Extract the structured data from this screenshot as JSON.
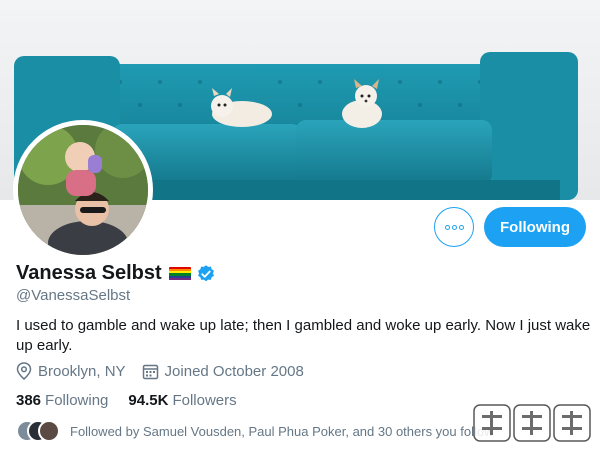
{
  "profile": {
    "display_name": "Vanessa Selbst",
    "handle": "@VanessaSelbst",
    "verified": true,
    "bio": "I used to gamble and wake up late; then I gambled and woke up early. Now I just wake up early.",
    "location": "Brooklyn, NY",
    "joined": "Joined October 2008"
  },
  "counts": {
    "following_value": "386",
    "following_label": "Following",
    "followers_value": "94.5K",
    "followers_label": "Followers"
  },
  "followed_by": "Followed by Samuel Vousden, Paul Phua Poker, and 30 others you follow",
  "actions": {
    "more_icon": "more-dots-icon",
    "follow_label": "Following"
  },
  "colors": {
    "accent": "#1da1f2",
    "couch": "#1b8fa5",
    "secondary_text": "#657786"
  },
  "icons": {
    "location": "location-pin-icon",
    "calendar": "calendar-icon",
    "verified": "verified-badge-icon",
    "flag": "rainbow-flag-icon"
  }
}
